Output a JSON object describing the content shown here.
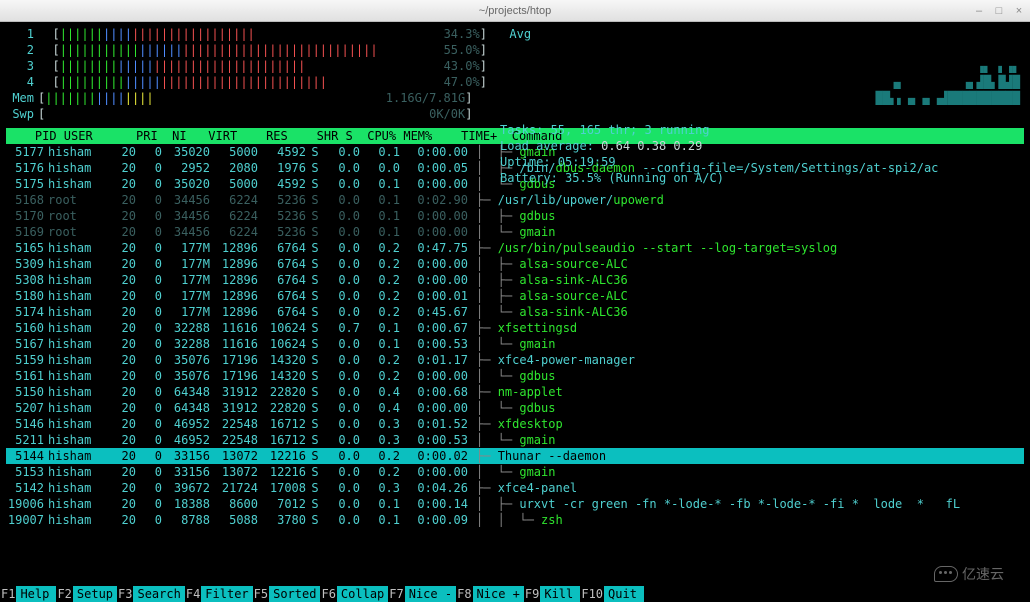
{
  "window": {
    "title": "~/projects/htop",
    "min": "–",
    "max": "□",
    "close": "×"
  },
  "cpu_meters": [
    {
      "id": "1",
      "bar": "|||||||||||||||||||||||||||",
      "pct": "34.3%"
    },
    {
      "id": "2",
      "bar": "||||||||||||||||||||||||||||||||||||||||||||",
      "pct": "55.0%"
    },
    {
      "id": "3",
      "bar": "||||||||||||||||||||||||||||||||||",
      "pct": "43.0%"
    },
    {
      "id": "4",
      "bar": "|||||||||||||||||||||||||||||||||||||",
      "pct": "47.0%"
    }
  ],
  "avg_label": "Avg",
  "mem": {
    "label": "Mem",
    "bar": "|||||||||||||||",
    "val": "1.16G/7.81G"
  },
  "swp": {
    "label": "Swp",
    "bar": "",
    "val": "0K/0K"
  },
  "stats": {
    "tasks_label": "Tasks:",
    "tasks": "55, 165 thr; 3 running",
    "la_label": "Load average:",
    "la": "0.64 0.38 0.29",
    "uptime_label": "Uptime:",
    "uptime": "05:19:59",
    "batt_label": "Battery:",
    "batt": "35.5% (Running on A/C)"
  },
  "headers": {
    "pid": "PID",
    "user": "USER",
    "pri": "PRI",
    "ni": "NI",
    "virt": "VIRT",
    "res": "RES",
    "shr": "SHR",
    "s": "S",
    "cpu": "CPU%",
    "mem": "MEM%",
    "time": "TIME+",
    "cmd": "Command"
  },
  "rows": [
    {
      "pid": "5177",
      "user": "hisham",
      "virt": "35020",
      "res": "5000",
      "shr": "4592",
      "cpu": "0.0",
      "mem": "0.1",
      "time": "0:00.00",
      "cmd": "gmain",
      "tree": "│  ├─ ",
      "vcolor": "cyan"
    },
    {
      "pid": "5176",
      "user": "hisham",
      "virt": "2952",
      "res": "2080",
      "shr": "1976",
      "cpu": "0.0",
      "mem": "0.0",
      "time": "0:00.05",
      "cmd": "/bin/dbus-daemon --config-file=/System/Settings/at-spi2/ac",
      "tree": "│  ├─ ",
      "vcolor": ""
    },
    {
      "pid": "5175",
      "user": "hisham",
      "virt": "35020",
      "res": "5000",
      "shr": "4592",
      "cpu": "0.0",
      "mem": "0.1",
      "time": "0:00.00",
      "cmd": "gdbus",
      "tree": "│  └─ ",
      "vcolor": "cyan",
      "hl": true
    },
    {
      "pid": "5168",
      "user": "root",
      "virt": "34456",
      "res": "6224",
      "shr": "5236",
      "cpu": "0.0",
      "mem": "0.1",
      "time": "0:02.90",
      "cmd": "/usr/lib/upower/upowerd",
      "tree": "├─ ",
      "dim": true
    },
    {
      "pid": "5170",
      "user": "root",
      "virt": "34456",
      "res": "6224",
      "shr": "5236",
      "cpu": "0.0",
      "mem": "0.1",
      "time": "0:00.00",
      "cmd": "gdbus",
      "tree": "│  ├─ ",
      "dim": true
    },
    {
      "pid": "5169",
      "user": "root",
      "virt": "34456",
      "res": "6224",
      "shr": "5236",
      "cpu": "0.0",
      "mem": "0.1",
      "time": "0:00.00",
      "cmd": "gmain",
      "tree": "│  └─ ",
      "dim": true
    },
    {
      "pid": "5165",
      "user": "hisham",
      "virt": "177M",
      "res": "12896",
      "shr": "6764",
      "cpu": "0.0",
      "mem": "0.2",
      "time": "0:47.75",
      "cmd": "/usr/bin/pulseaudio --start --log-target=syslog",
      "tree": "├─ ",
      "vcolor": "cyan",
      "hl": true
    },
    {
      "pid": "5309",
      "user": "hisham",
      "virt": "177M",
      "res": "12896",
      "shr": "6764",
      "cpu": "0.0",
      "mem": "0.2",
      "time": "0:00.00",
      "cmd": "alsa-source-ALC",
      "tree": "│  ├─ ",
      "vcolor": "cyan",
      "hl": true
    },
    {
      "pid": "5308",
      "user": "hisham",
      "virt": "177M",
      "res": "12896",
      "shr": "6764",
      "cpu": "0.0",
      "mem": "0.2",
      "time": "0:00.00",
      "cmd": "alsa-sink-ALC36",
      "tree": "│  ├─ ",
      "vcolor": "cyan",
      "hl": true
    },
    {
      "pid": "5180",
      "user": "hisham",
      "virt": "177M",
      "res": "12896",
      "shr": "6764",
      "cpu": "0.0",
      "mem": "0.2",
      "time": "0:00.01",
      "cmd": "alsa-source-ALC",
      "tree": "│  ├─ ",
      "vcolor": "cyan",
      "hl": true
    },
    {
      "pid": "5174",
      "user": "hisham",
      "virt": "177M",
      "res": "12896",
      "shr": "6764",
      "cpu": "0.0",
      "mem": "0.2",
      "time": "0:45.67",
      "cmd": "alsa-sink-ALC36",
      "tree": "│  └─ ",
      "vcolor": "cyan",
      "hl": true
    },
    {
      "pid": "5160",
      "user": "hisham",
      "virt": "32288",
      "res": "11616",
      "shr": "10624",
      "cpu": "0.7",
      "mem": "0.1",
      "time": "0:00.67",
      "cmd": "xfsettingsd",
      "tree": "├─ "
    },
    {
      "pid": "5167",
      "user": "hisham",
      "virt": "32288",
      "res": "11616",
      "shr": "10624",
      "cpu": "0.0",
      "mem": "0.1",
      "time": "0:00.53",
      "cmd": "gmain",
      "tree": "│  └─ ",
      "hl": true
    },
    {
      "pid": "5159",
      "user": "hisham",
      "virt": "35076",
      "res": "17196",
      "shr": "14320",
      "cpu": "0.0",
      "mem": "0.2",
      "time": "0:01.17",
      "cmd": "xfce4-power-manager",
      "tree": "├─ "
    },
    {
      "pid": "5161",
      "user": "hisham",
      "virt": "35076",
      "res": "17196",
      "shr": "14320",
      "cpu": "0.0",
      "mem": "0.2",
      "time": "0:00.00",
      "cmd": "gdbus",
      "tree": "│  └─ ",
      "hl": true
    },
    {
      "pid": "5150",
      "user": "hisham",
      "virt": "64348",
      "res": "31912",
      "shr": "22820",
      "cpu": "0.0",
      "mem": "0.4",
      "time": "0:00.68",
      "cmd": "nm-applet",
      "tree": "├─ "
    },
    {
      "pid": "5207",
      "user": "hisham",
      "virt": "64348",
      "res": "31912",
      "shr": "22820",
      "cpu": "0.0",
      "mem": "0.4",
      "time": "0:00.00",
      "cmd": "gdbus",
      "tree": "│  └─ ",
      "hl": true
    },
    {
      "pid": "5146",
      "user": "hisham",
      "virt": "46952",
      "res": "22548",
      "shr": "16712",
      "cpu": "0.0",
      "mem": "0.3",
      "time": "0:01.52",
      "cmd": "xfdesktop",
      "tree": "├─ "
    },
    {
      "pid": "5211",
      "user": "hisham",
      "virt": "46952",
      "res": "22548",
      "shr": "16712",
      "cpu": "0.0",
      "mem": "0.3",
      "time": "0:00.53",
      "cmd": "gmain",
      "tree": "│  └─ ",
      "hl": true
    },
    {
      "pid": "5144",
      "user": "hisham",
      "virt": "33156",
      "res": "13072",
      "shr": "12216",
      "cpu": "0.0",
      "mem": "0.2",
      "time": "0:00.02",
      "cmd": "Thunar --daemon",
      "tree": "├─ ",
      "sel": true
    },
    {
      "pid": "5153",
      "user": "hisham",
      "virt": "33156",
      "res": "13072",
      "shr": "12216",
      "cpu": "0.0",
      "mem": "0.2",
      "time": "0:00.00",
      "cmd": "gmain",
      "tree": "│  └─ ",
      "hl": true
    },
    {
      "pid": "5142",
      "user": "hisham",
      "virt": "39672",
      "res": "21724",
      "shr": "17008",
      "cpu": "0.0",
      "mem": "0.3",
      "time": "0:04.26",
      "cmd": "xfce4-panel",
      "tree": "├─ "
    },
    {
      "pid": "19006",
      "user": "hisham",
      "virt": "18388",
      "res": "8600",
      "shr": "7012",
      "cpu": "0.0",
      "mem": "0.1",
      "time": "0:00.14",
      "cmd": "urxvt -cr green -fn *-lode-* -fb *-lode-* -fi *  lode  *   fL",
      "tree": "│  ├─ "
    },
    {
      "pid": "19007",
      "user": "hisham",
      "virt": "8788",
      "res": "5088",
      "shr": "3780",
      "cpu": "0.0",
      "mem": "0.1",
      "time": "0:00.09",
      "cmd": "zsh",
      "tree": "│  │  └─ ",
      "hl": true
    }
  ],
  "fkeys": [
    {
      "n": "F1",
      "l": "Help"
    },
    {
      "n": "F2",
      "l": "Setup"
    },
    {
      "n": "F3",
      "l": "Search"
    },
    {
      "n": "F4",
      "l": "Filter"
    },
    {
      "n": "F5",
      "l": "Sorted"
    },
    {
      "n": "F6",
      "l": "Collap"
    },
    {
      "n": "F7",
      "l": "Nice -"
    },
    {
      "n": "F8",
      "l": "Nice +"
    },
    {
      "n": "F9",
      "l": "Kill"
    },
    {
      "n": "F10",
      "l": "Quit"
    }
  ],
  "watermark": "亿速云"
}
